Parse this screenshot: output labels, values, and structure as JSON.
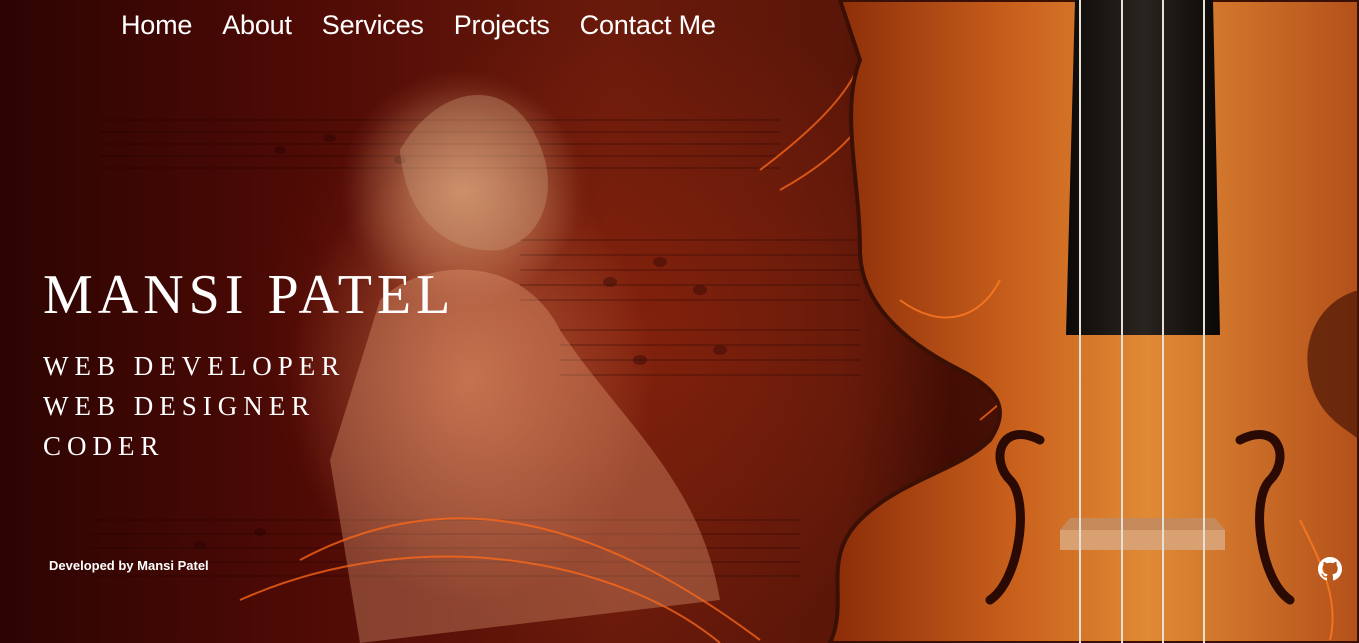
{
  "nav": {
    "items": [
      {
        "label": "Home"
      },
      {
        "label": "About"
      },
      {
        "label": "Services"
      },
      {
        "label": "Projects"
      },
      {
        "label": "Contact Me"
      }
    ]
  },
  "hero": {
    "name": "MANSI PATEL",
    "roles": [
      "WEB DEVELOPER",
      "WEB DESIGNER",
      "CODER"
    ]
  },
  "footer": {
    "credit": "Developed by Mansi Patel",
    "github_icon": "github-icon"
  },
  "colors": {
    "text": "#ffffff",
    "background_dark": "#2c0402",
    "violin_wood": "#c0551a",
    "accent_glow": "#ff6a1a"
  }
}
